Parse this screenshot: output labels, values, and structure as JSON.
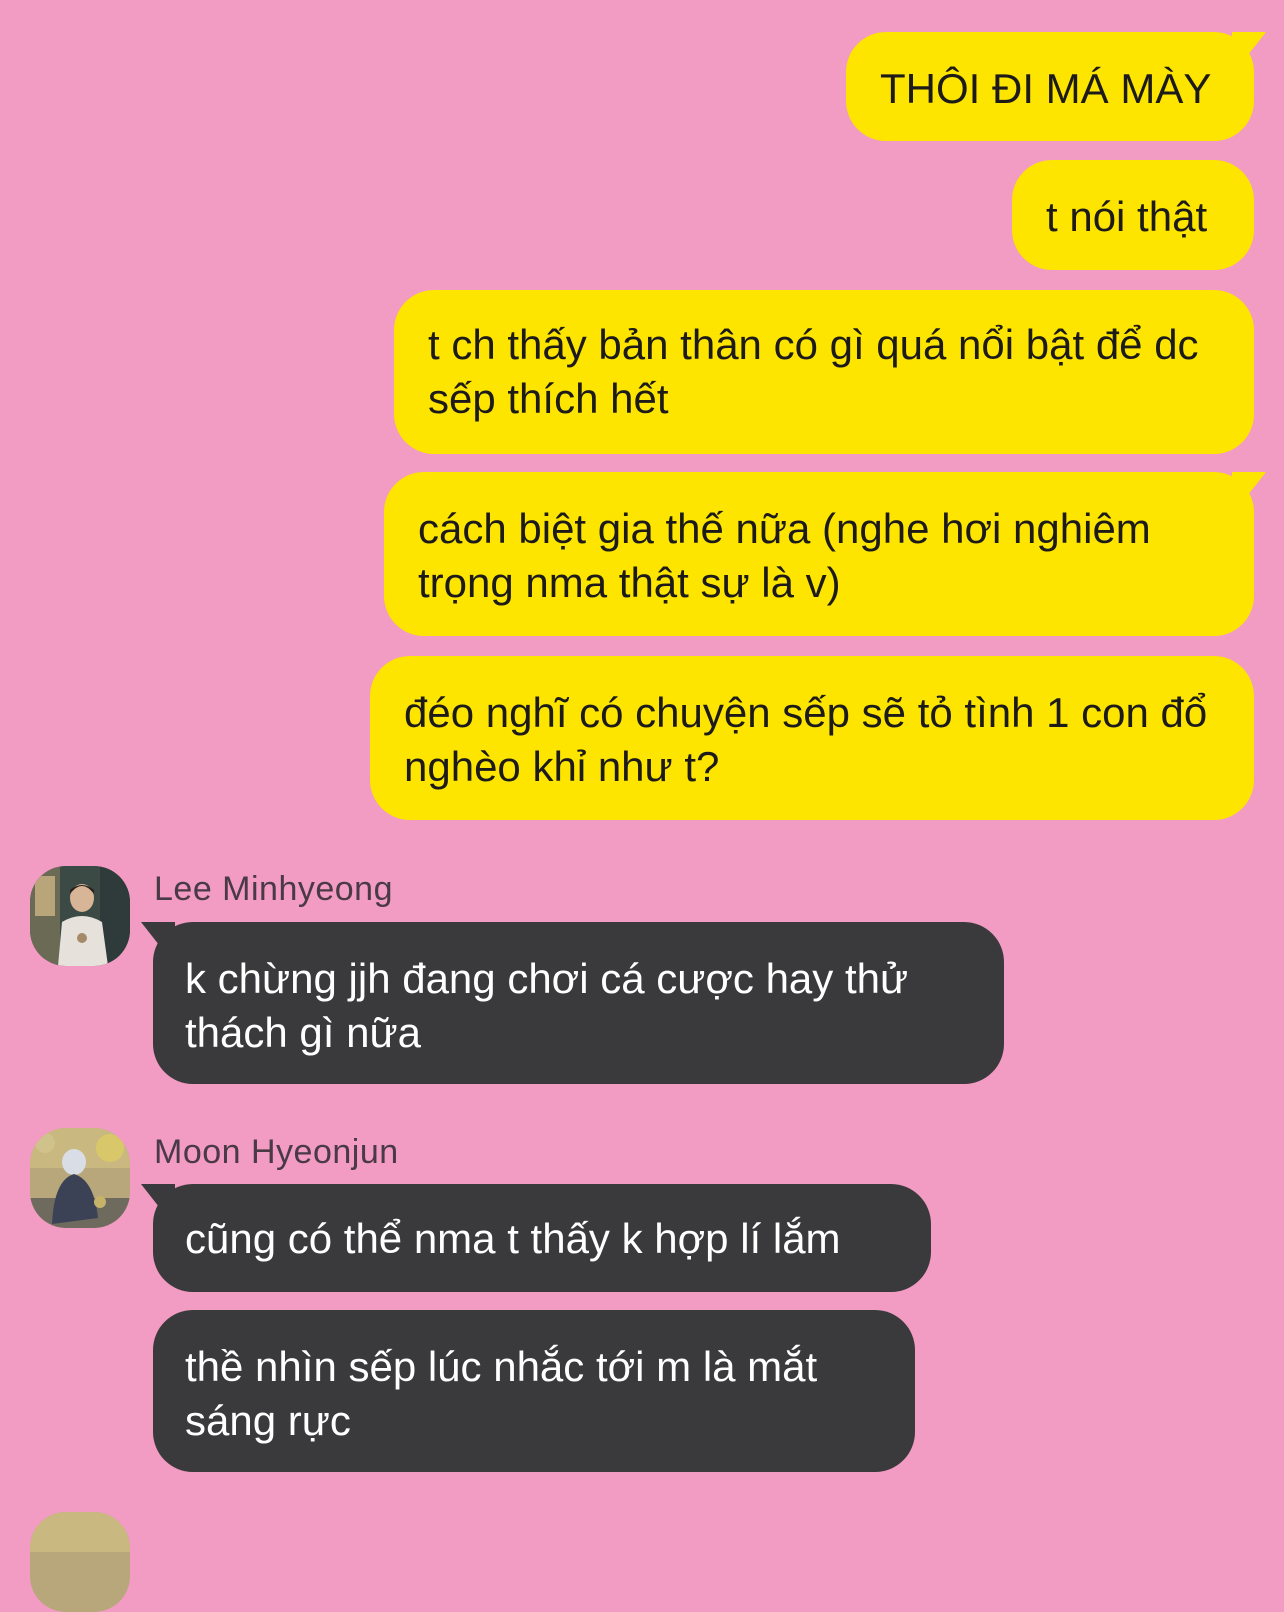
{
  "colors": {
    "background": "#f29bc3",
    "outgoing_bubble": "#fde500",
    "incoming_bubble": "#3a393b",
    "outgoing_text": "#1d1a1a",
    "incoming_text": "#ffffff",
    "sender_name": "#4a3a45"
  },
  "messages_out": [
    {
      "text": "THÔI ĐI MÁ MÀY"
    },
    {
      "text": "t nói thật"
    },
    {
      "text": "t ch thấy bản thân có gì quá nổi bật để dc sếp thích hết"
    },
    {
      "text": "cách biệt gia thế nữa (nghe hơi nghiêm trọng nma thật sự là v)"
    },
    {
      "text": "đéo nghĩ có chuyện sếp sẽ tỏ tình 1 con đổ nghèo khỉ như t?"
    }
  ],
  "groups": [
    {
      "sender": "Lee Minhyeong",
      "avatar_icon": "profile-photo-icon",
      "messages": [
        {
          "text": "k chừng jjh đang chơi cá cược hay thử thách gì nữa"
        }
      ]
    },
    {
      "sender": "Moon Hyeonjun",
      "avatar_icon": "profile-photo-icon",
      "messages": [
        {
          "text": "cũng có thể nma t thấy k hợp lí lắm"
        },
        {
          "text": "thề nhìn sếp lúc nhắc tới m là mắt sáng rực"
        }
      ]
    }
  ]
}
